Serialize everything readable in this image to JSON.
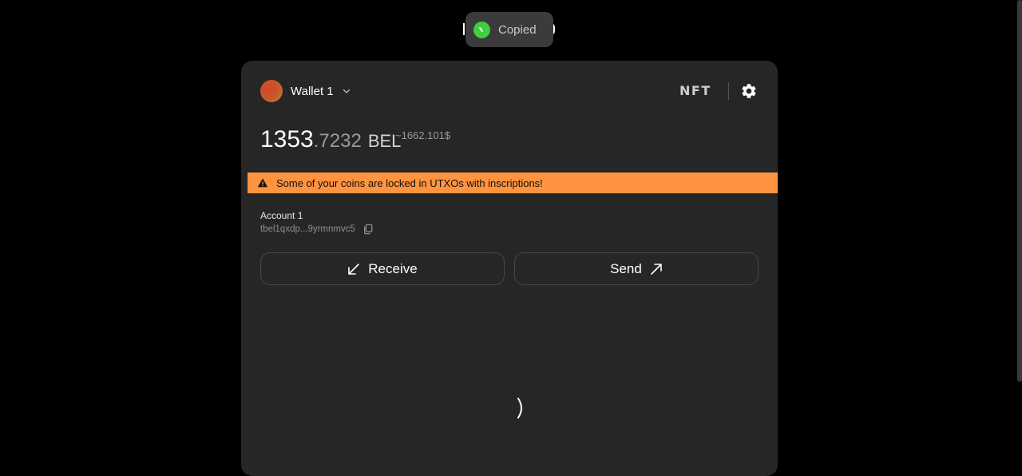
{
  "toast": {
    "text": "Copied",
    "icon": "success-check-icon",
    "icon_color": "#3fcf3f"
  },
  "header": {
    "wallet_name": "Wallet 1",
    "nft_label": "NFT",
    "settings_icon": "gear-icon"
  },
  "balance": {
    "integer": "1353",
    "decimal": ".7232",
    "currency": "BEL",
    "usd": "~1662.101$"
  },
  "warning": {
    "text": "Some of your coins are locked in UTXOs with inscriptions!",
    "color": "#ff9340",
    "icon": "warning-triangle-icon"
  },
  "account": {
    "name": "Account 1",
    "address": "tbel1qxdp...9yrmnmvc5",
    "copy_icon": "copy-icon"
  },
  "actions": {
    "receive_label": "Receive",
    "receive_icon": "arrow-down-left-icon",
    "send_label": "Send",
    "send_icon": "arrow-up-right-icon"
  },
  "colors": {
    "background": "#000000",
    "card": "#262626",
    "accent_warning": "#ff9340"
  }
}
